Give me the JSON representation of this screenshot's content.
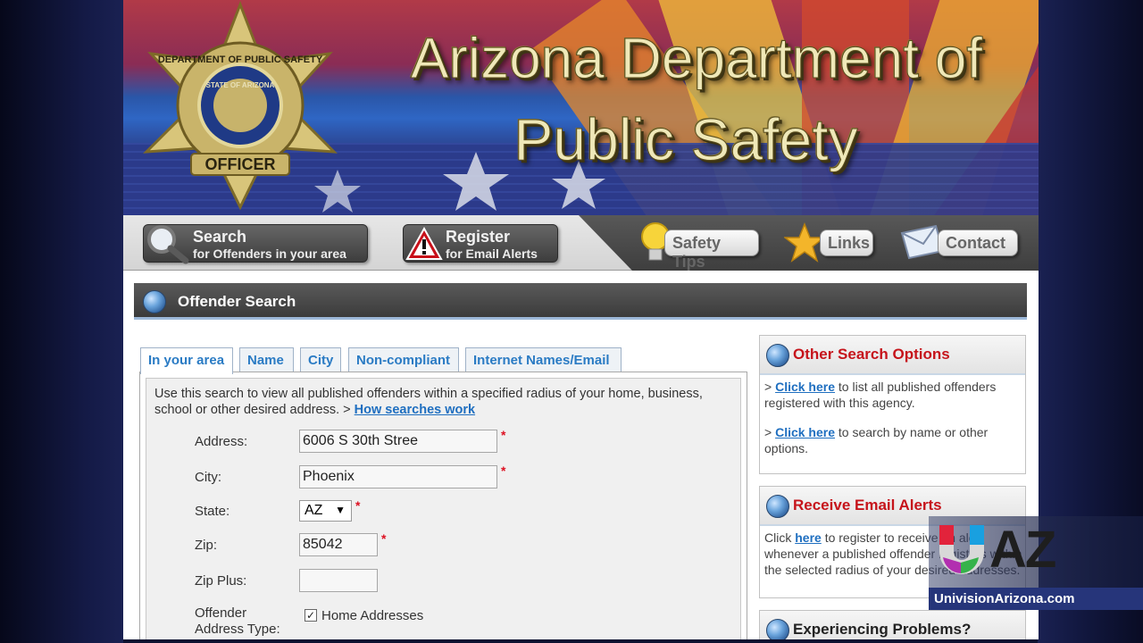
{
  "banner": {
    "title_line1": "Arizona Department of",
    "title_line2": "Public Safety",
    "badge_text_top": "DEPARTMENT OF PUBLIC SAFETY",
    "badge_text_mid": "STATE OF ARIZONA",
    "badge_text_bottom": "OFFICER"
  },
  "nav": {
    "search": {
      "title": "Search",
      "subtitle": "for Offenders in your area"
    },
    "register": {
      "title": "Register",
      "subtitle": "for Email Alerts"
    },
    "safety_tips": "Safety Tips",
    "links": "Links",
    "contact": "Contact"
  },
  "section": {
    "title": "Offender Search"
  },
  "tabs": [
    {
      "label": "In your area"
    },
    {
      "label": "Name"
    },
    {
      "label": "City"
    },
    {
      "label": "Non-compliant"
    },
    {
      "label": "Internet Names/Email"
    }
  ],
  "form": {
    "description": "Use this search to view all published offenders within a specified radius of your home, business, school or other desired address. > ",
    "how_link": "How searches work",
    "address_label": "Address:",
    "address_value": "6006 S 30th Stree",
    "city_label": "City:",
    "city_value": "Phoenix",
    "state_label": "State:",
    "state_value": "AZ",
    "zip_label": "Zip:",
    "zip_value": "85042",
    "zipplus_label": "Zip Plus:",
    "zipplus_value": "",
    "offender_type_label_1": "Offender",
    "offender_type_label_2": "Address Type:",
    "home_addresses_label": "Home Addresses",
    "required_mark": "*"
  },
  "sidebar": {
    "other": {
      "title": "Other Search Options",
      "item1_prefix": "> ",
      "item1_link": "Click here",
      "item1_text": " to list all published offenders registered with this agency.",
      "item2_prefix": "> ",
      "item2_link": "Click here",
      "item2_text": " to search by name or other options."
    },
    "alerts": {
      "title": "Receive Email Alerts",
      "prefix": "Click ",
      "link": "here",
      "text": " to register to receive an alert whenever a published offender registers within the selected radius of your desired addresses."
    },
    "problems": {
      "title": "Experiencing Problems?"
    }
  },
  "overlay": {
    "logo_text": "AZ",
    "url": "UnivisionArizona.com"
  },
  "colors": {
    "accent_red": "#c6141b",
    "link_blue": "#1f6fc0",
    "header_dark": "#3b3b3b"
  }
}
